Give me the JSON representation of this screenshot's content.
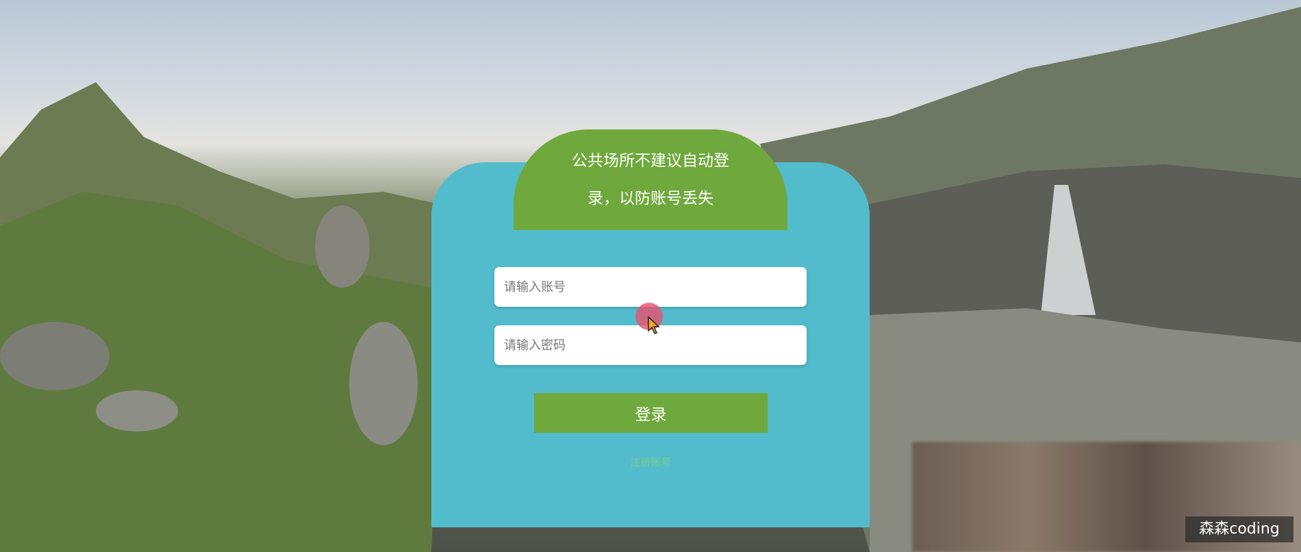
{
  "notice": {
    "text": "公共场所不建议自动登录，以防账号丢失"
  },
  "form": {
    "account_placeholder": "请输入账号",
    "password_placeholder": "请输入密码",
    "login_label": "登录",
    "register_label": "注册账号"
  },
  "watermark": {
    "text": "森森coding"
  },
  "colors": {
    "card": "#52bccd",
    "accent_green": "#6fa83c"
  }
}
